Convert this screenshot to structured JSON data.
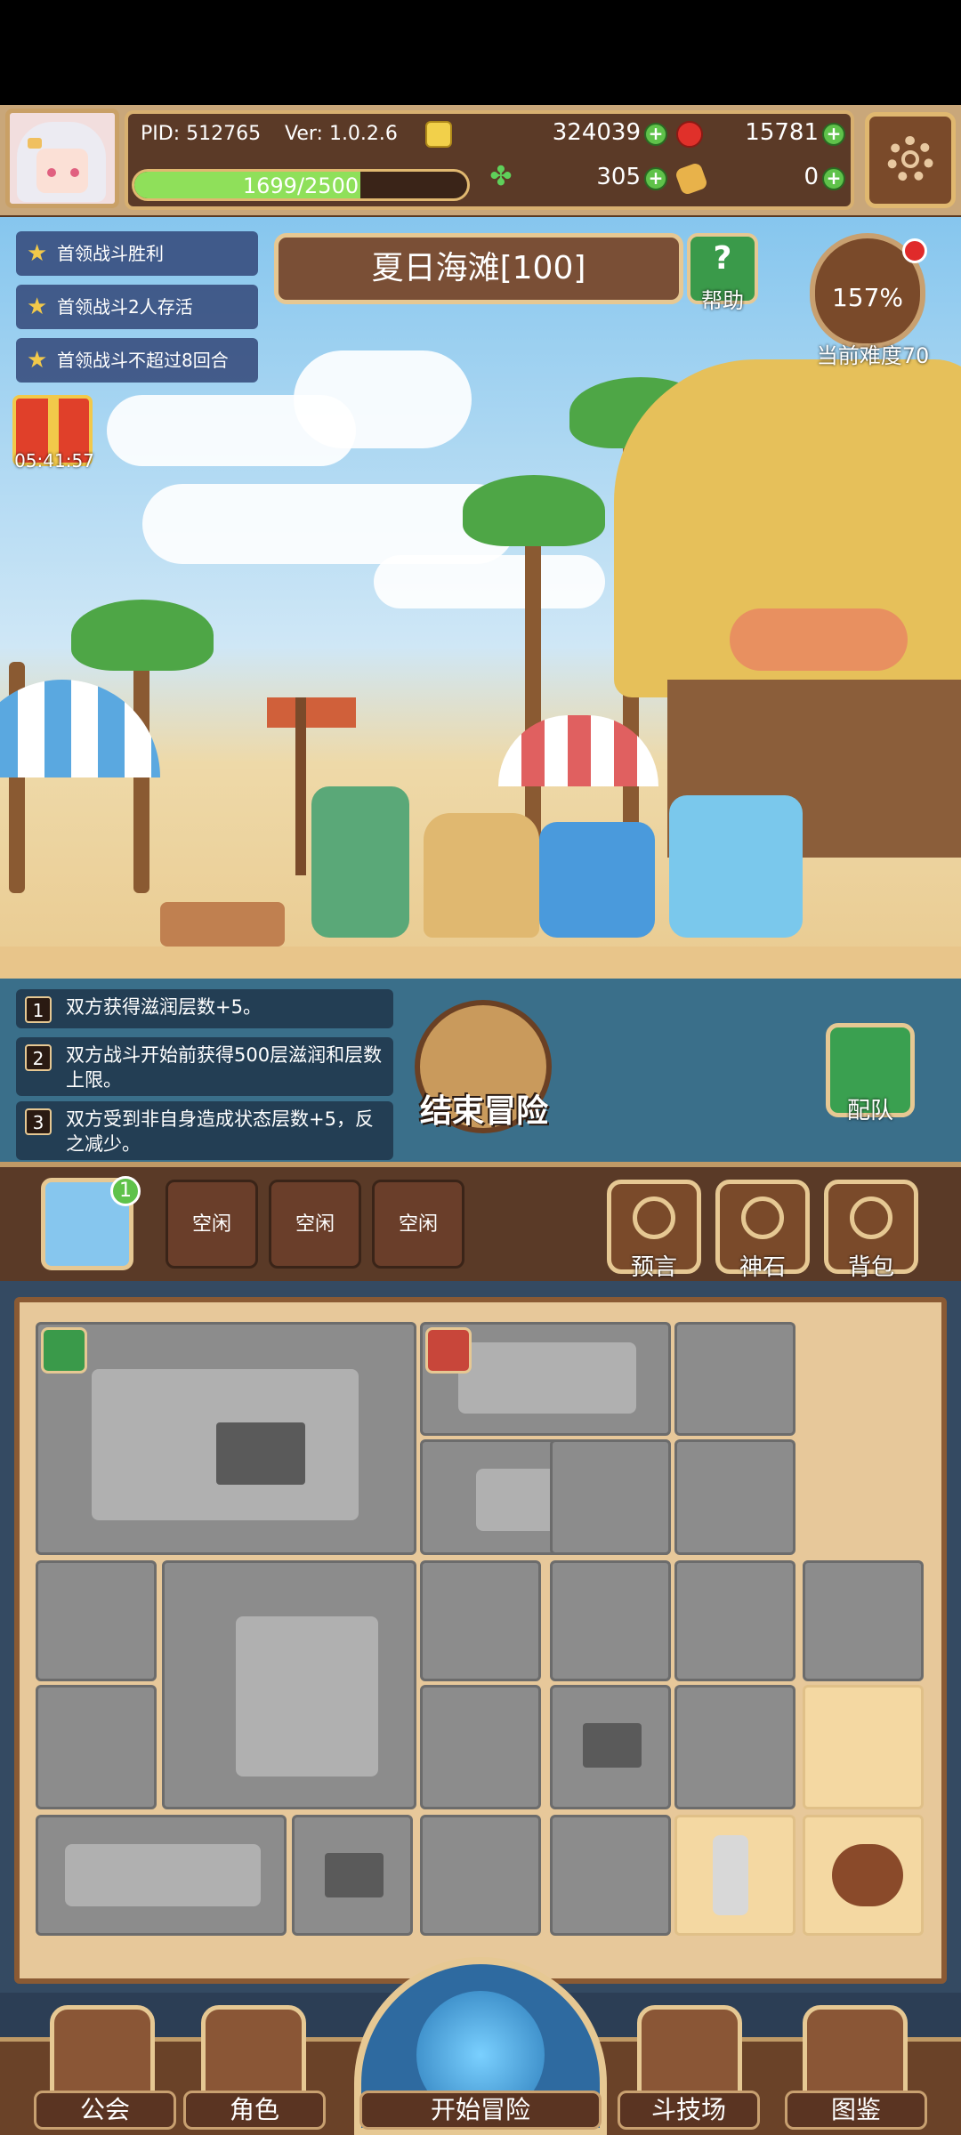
{
  "header": {
    "pid": "PID: 512765",
    "version": "Ver: 1.0.2.6",
    "gold": "324039",
    "ruby": "15781",
    "clover": "305",
    "bread": "0",
    "xp_text": "1699/2500",
    "xp_progress": 0.68
  },
  "quests": [
    {
      "label": "首领战斗胜利"
    },
    {
      "label": "首领战斗2人存活"
    },
    {
      "label": "首领战斗不超过8回合"
    }
  ],
  "stage": {
    "title": "夏日海滩[100]",
    "help_label": "帮助",
    "difficulty_pct": "157%",
    "difficulty_label": "当前难度70",
    "timer": "05:41:57"
  },
  "effects": [
    {
      "num": "1",
      "text": "双方获得滋润层数+5。"
    },
    {
      "num": "2",
      "text": "双方战斗开始前获得500层滋润和层数上限。"
    },
    {
      "num": "3",
      "text": "双方受到非自身造成状态层数+5，反之减少。"
    }
  ],
  "actions": {
    "end_adventure": "结束冒险",
    "team": "配队"
  },
  "toolbar": {
    "map_badge": "1",
    "slots": [
      "空闲",
      "空闲",
      "空闲"
    ],
    "buttons": [
      "预言",
      "神石",
      "背包"
    ]
  },
  "nav": {
    "guild": "公会",
    "character": "角色",
    "start": "开始冒险",
    "arena": "斗技场",
    "codex": "图鉴"
  },
  "colors": {
    "accent_gold": "#e6c893",
    "panel_brown": "#5b3a27",
    "xp_green": "#8fe05a",
    "grid_locked": "#8c8c8c"
  }
}
